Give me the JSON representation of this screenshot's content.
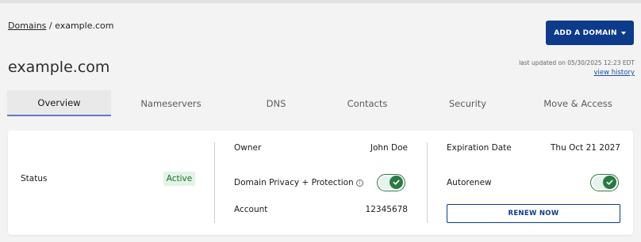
{
  "breadcrumb": {
    "root": "Domains",
    "separator": " / ",
    "current": "example.com"
  },
  "header": {
    "add_domain_label": "ADD A DOMAIN",
    "title": "example.com",
    "last_updated": "last updated on 05/30/2025 12:23 EDT",
    "view_history": "view history"
  },
  "tabs": [
    {
      "label": "Overview",
      "active": true
    },
    {
      "label": "Nameservers"
    },
    {
      "label": "DNS"
    },
    {
      "label": "Contacts"
    },
    {
      "label": "Security"
    },
    {
      "label": "Move & Access"
    }
  ],
  "overview": {
    "status_label": "Status",
    "status_value": "Active",
    "owner_label": "Owner",
    "owner_value": "John Doe",
    "privacy_label": "Domain Privacy + Protection",
    "privacy_enabled": true,
    "account_label": "Account",
    "account_value": "12345678",
    "expiration_label": "Expiration Date",
    "expiration_value": "Thu Oct 21 2027",
    "autorenew_label": "Autorenew",
    "autorenew_enabled": true,
    "renew_label": "RENEW NOW"
  },
  "icons": {
    "info": "info-icon",
    "check": "check-icon",
    "dropdown": "chevron-down-icon"
  },
  "colors": {
    "primary": "#0d3a8a",
    "success": "#2b7a43",
    "badge_bg": "#e3f3e6",
    "link": "#1a4ea7"
  }
}
